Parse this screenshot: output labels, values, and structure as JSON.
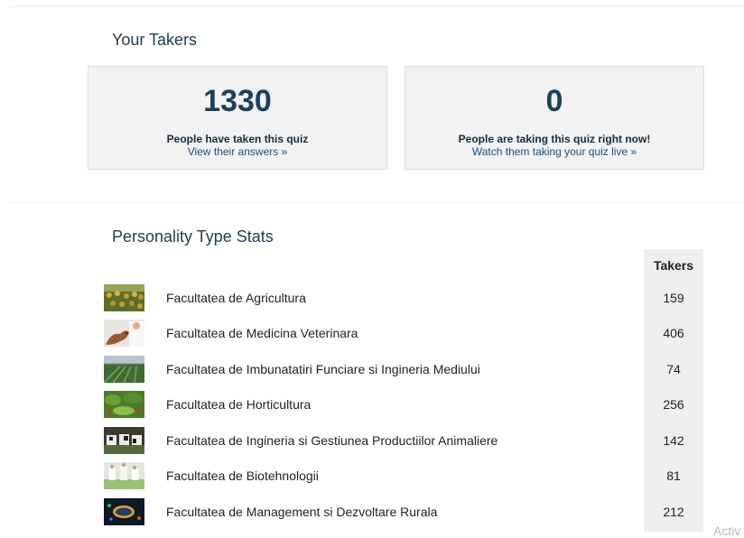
{
  "takers_section": {
    "title": "Your Takers",
    "total_card": {
      "number": "1330",
      "description": "People have taken this quiz",
      "link": "View their answers »"
    },
    "live_card": {
      "number": "0",
      "description": "People are taking this quiz right now!",
      "link": "Watch them taking your quiz live »"
    }
  },
  "stats_section": {
    "title": "Personality Type Stats",
    "column_header": "Takers",
    "rows": [
      {
        "label": "Facultatea de Agricultura",
        "count": "159",
        "icon": "sunflower-field-thumbnail"
      },
      {
        "label": "Facultatea de Medicina Veterinara",
        "count": "406",
        "icon": "veterinarian-dog-thumbnail"
      },
      {
        "label": "Facultatea de Imbunatatiri Funciare si Ingineria Mediului",
        "count": "74",
        "icon": "greenhouse-thumbnail"
      },
      {
        "label": "Facultatea de Horticultura",
        "count": "256",
        "icon": "garden-thumbnail"
      },
      {
        "label": "Facultatea de Ingineria si Gestiunea Productiilor Animaliere",
        "count": "142",
        "icon": "cattle-thumbnail"
      },
      {
        "label": "Facultatea de Biotehnologii",
        "count": "81",
        "icon": "lab-plants-thumbnail"
      },
      {
        "label": "Facultatea de Management si Dezvoltare Rurala",
        "count": "212",
        "icon": "business-logo-thumbnail"
      }
    ]
  },
  "watermark": "Activ"
}
